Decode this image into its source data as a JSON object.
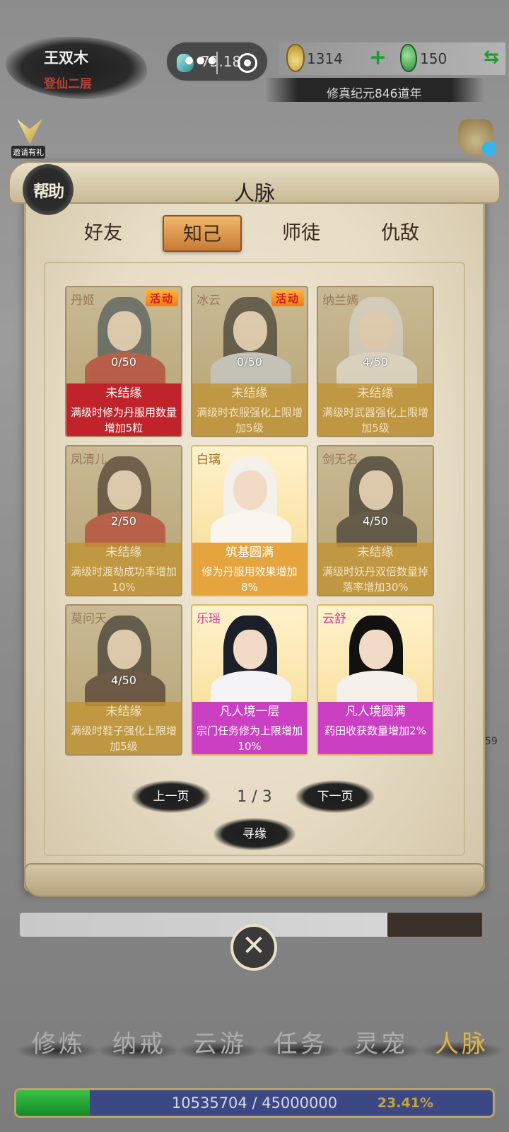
{
  "player": {
    "name": "王双木",
    "realm": "登仙二层"
  },
  "capsule": {
    "value": "73.18"
  },
  "resources": {
    "coins": "1314",
    "jade": "150",
    "plus": "+",
    "swap": "⇆"
  },
  "era": "修真纪元846道年",
  "invite_caption": "邀请有礼",
  "help_label": "帮助",
  "panel": {
    "title": "人脉",
    "tabs": [
      {
        "label": "好友",
        "active": false
      },
      {
        "label": "知己",
        "active": true
      },
      {
        "label": "师徒",
        "active": false
      },
      {
        "label": "仇敌",
        "active": false
      }
    ],
    "cards": [
      {
        "name": "丹姬",
        "event": "活动",
        "progress": "0/50",
        "status": "未结缘",
        "effect": "满级时修为丹服用数量增加5粒",
        "style": "red",
        "hair": "#2a3f4d",
        "robe": "#b3201c"
      },
      {
        "name": "冰云",
        "event": "活动",
        "progress": "0/50",
        "status": "未结缘",
        "effect": "满级时衣服强化上限增加5级",
        "style": "amber",
        "hair": "#1b1b1b",
        "robe": "#c9d4e2"
      },
      {
        "name": "纳兰嫣",
        "event": "",
        "progress": "4/50",
        "status": "未结缘",
        "effect": "满级时武器强化上限增加5级",
        "style": "amber",
        "hair": "#dcdcdc",
        "robe": "#efefef"
      },
      {
        "name": "凤清儿",
        "event": "",
        "progress": "2/50",
        "status": "未结缘",
        "effect": "满级时渡劫成功率增加10%",
        "style": "amber",
        "hair": "#2a1a14",
        "robe": "#b3241e"
      },
      {
        "name": "白璃",
        "event": "",
        "progress": "",
        "status": "筑基圆满",
        "effect": "修为丹服用效果增加8%",
        "style": "orange",
        "hair": "#f4f1ea",
        "robe": "#faf6ee"
      },
      {
        "name": "剑无名",
        "event": "",
        "progress": "4/50",
        "status": "未结缘",
        "effect": "满级时妖丹双倍数量掉落率增加30%",
        "style": "amber",
        "hair": "#111111",
        "robe": "#1b1b1b"
      },
      {
        "name": "莫问天",
        "event": "",
        "progress": "4/50",
        "status": "未结缘",
        "effect": "满级时鞋子强化上限增加5级",
        "style": "amber",
        "hair": "#151515",
        "robe": "#2a1616"
      },
      {
        "name": "乐瑶",
        "event": "",
        "progress": "",
        "status": "凡人境一层",
        "effect": "宗门任务修为上限增加10%",
        "style": "magenta",
        "hair": "#1a1f2a",
        "robe": "#f4f4f6"
      },
      {
        "name": "云舒",
        "event": "",
        "progress": "",
        "status": "凡人境圆满",
        "effect": "药田收获数量增加2%",
        "style": "magenta",
        "hair": "#111111",
        "robe": "#f5f1ea"
      }
    ],
    "prev_label": "上一页",
    "page": "1 / 3",
    "next_label": "下一页",
    "seek_label": "寻缘"
  },
  "side_number": "59",
  "close_icon": "close-icon",
  "nav": [
    {
      "label": "修炼",
      "active": false
    },
    {
      "label": "纳戒",
      "active": false
    },
    {
      "label": "云游",
      "active": false
    },
    {
      "label": "任务",
      "active": false
    },
    {
      "label": "灵宠",
      "active": false
    },
    {
      "label": "人脉",
      "active": true
    }
  ],
  "exp": {
    "text": "10535704 / 45000000",
    "percent": "23.41%",
    "fill_fraction": 0.2341
  }
}
